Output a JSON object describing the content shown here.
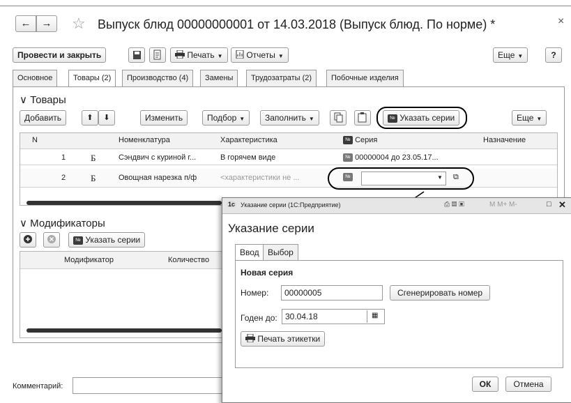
{
  "window": {
    "title": "Выпуск блюд 00000000001 от 14.03.2018 (Выпуск блюд. По норме) *",
    "close_glyph": "×",
    "back_glyph": "←",
    "forward_glyph": "→",
    "star_glyph": "☆"
  },
  "toolbar": {
    "post_close": "Провести и закрыть",
    "print": "Печать",
    "reports": "Отчеты",
    "more": "Еще",
    "help": "?"
  },
  "tabs": [
    "Основное",
    "Товары (2)",
    "Производство (4)",
    "Замены",
    "Трудозатраты (2)",
    "Побочные изделия"
  ],
  "goods": {
    "section_title": "Товары",
    "add": "Добавить",
    "change": "Изменить",
    "pick": "Подбор",
    "fill": "Заполнить",
    "set_series": "Указать серии",
    "more": "Еще",
    "headers": {
      "n": "N",
      "nomenclature": "Номенклатура",
      "characteristic": "Характеристика",
      "series": "Серия",
      "purpose": "Назначение"
    },
    "rows": [
      {
        "n": "1",
        "type": "Б",
        "nomenclature": "Сэндвич с куриной г...",
        "characteristic": "В горячем виде",
        "series": "00000004 до 23.05.17...",
        "purpose": ""
      },
      {
        "n": "2",
        "type": "Б",
        "nomenclature": "Овощная нарезка п/ф",
        "characteristic": "<характеристики не ...",
        "series": "",
        "purpose": ""
      }
    ],
    "no_badge": "№"
  },
  "modifiers": {
    "section_title": "Модификаторы",
    "set_series": "Указать серии",
    "headers": {
      "modifier": "Модификатор",
      "quantity": "Количество"
    }
  },
  "comment_label": "Комментарий:",
  "dialog": {
    "window_title": "Указание серии  (1С:Предприятие)",
    "title_buttons": "M  M+  M-",
    "heading": "Указание серии",
    "tabs": [
      "Ввод",
      "Выбор"
    ],
    "group_title": "Новая серия",
    "number_label": "Номер:",
    "number_value": "00000005",
    "generate": "Сгенерировать номер",
    "expiry_label": "Годен до:",
    "expiry_value": "30.04.18",
    "print_labels": "Печать этикетки",
    "ok": "ОК",
    "cancel": "Отмена"
  }
}
